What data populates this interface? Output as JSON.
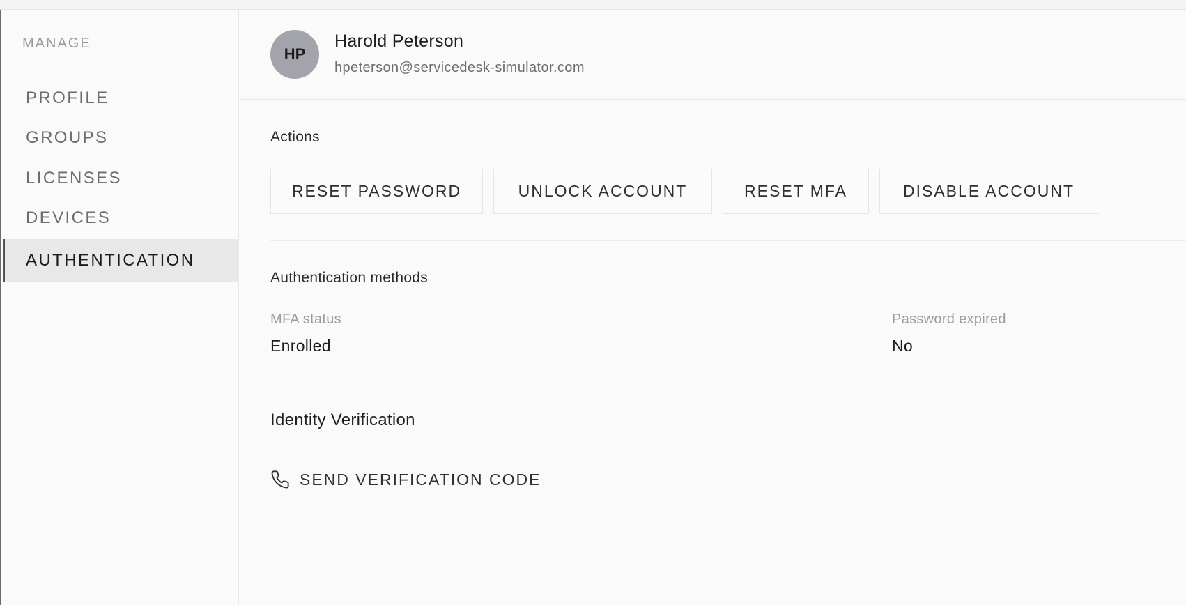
{
  "sidebar": {
    "heading": "MANAGE",
    "items": [
      {
        "label": "PROFILE",
        "active": false
      },
      {
        "label": "GROUPS",
        "active": false
      },
      {
        "label": "LICENSES",
        "active": false
      },
      {
        "label": "DEVICES",
        "active": false
      },
      {
        "label": "AUTHENTICATION",
        "active": true
      }
    ]
  },
  "user": {
    "initials": "HP",
    "name": "Harold Peterson",
    "email": "hpeterson@servicedesk-simulator.com"
  },
  "actions": {
    "title": "Actions",
    "buttons": [
      {
        "label": "RESET PASSWORD"
      },
      {
        "label": "UNLOCK ACCOUNT"
      },
      {
        "label": "RESET MFA"
      },
      {
        "label": "DISABLE ACCOUNT"
      }
    ]
  },
  "auth_methods": {
    "title": "Authentication methods",
    "mfa_status": {
      "label": "MFA status",
      "value": "Enrolled"
    },
    "password_expired": {
      "label": "Password expired",
      "value": "No"
    }
  },
  "identity_verification": {
    "title": "Identity Verification",
    "send_code_label": "SEND VERIFICATION CODE",
    "icon": "phone-icon"
  },
  "colors": {
    "avatar_bg": "#a3a3ab",
    "active_nav_bg": "#e8e8e9",
    "text_primary": "#1e1e1e",
    "text_muted": "#9b9b9b"
  }
}
